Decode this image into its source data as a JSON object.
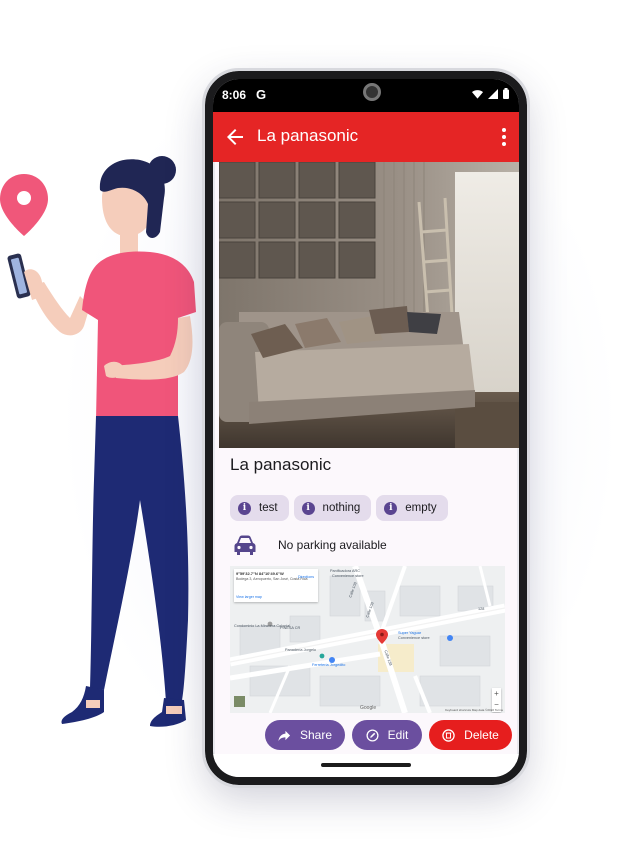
{
  "status_bar": {
    "time": "8:06",
    "carrier_icon": "G",
    "icons": [
      "wifi-icon",
      "signal-icon",
      "battery-icon"
    ]
  },
  "app_bar": {
    "title": "La panasonic",
    "back_icon": "arrow-back-icon",
    "menu_icon": "more-vert-icon",
    "color": "#e52525"
  },
  "property": {
    "name": "La panasonic",
    "photo": "living-room-sofa-photo",
    "tags": [
      "test",
      "nothing",
      "empty"
    ],
    "parking": "No parking available",
    "parking_icon": "car-icon"
  },
  "map": {
    "card_title": "9°59'32.7\"N 84°10'49.6\"W",
    "card_address": "Bodega 3, Aeropuerto, San José, Costa Rica",
    "card_link": "View larger map",
    "card_directions": "Directions",
    "labels": {
      "ferreteria": "Ferretería Jorgedito",
      "super": "Super Yaguar",
      "super_sub": "Convenience store",
      "condominio": "Condominio La Miravera Colonial",
      "panaderia": "Panadería Jorgelo",
      "panificadora": "Panificadora ARC",
      "panificadora_sub": "Convenience store",
      "pinesa": "PINESA CR",
      "calle_108a": "Calle 108",
      "calle_108b": "Calle 108",
      "calle_138": "Calle 138",
      "road_128": "128"
    },
    "footer": "Keyboard shortcuts   Map data ©2022   Terms",
    "google": "Google",
    "pin_color": "#e53935"
  },
  "actions": {
    "share": "Share",
    "edit": "Edit",
    "delete": "Delete"
  }
}
